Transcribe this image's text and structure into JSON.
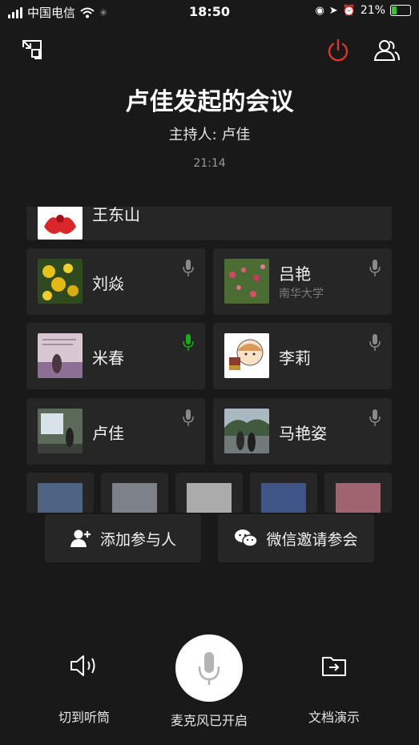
{
  "status": {
    "carrier": "中国电信",
    "time": "18:50",
    "battery": "21%"
  },
  "meeting": {
    "title": "卢佳发起的会议",
    "host_label": "主持人: 卢佳",
    "timer": "21:14"
  },
  "participants": [
    {
      "name": "王东山",
      "sub": "",
      "mic_active": false
    },
    {
      "name": "刘焱",
      "sub": "",
      "mic_active": false
    },
    {
      "name": "吕艳",
      "sub": "南华大学",
      "mic_active": false
    },
    {
      "name": "米春",
      "sub": "",
      "mic_active": true
    },
    {
      "name": "李莉",
      "sub": "",
      "mic_active": false
    },
    {
      "name": "卢佳",
      "sub": "",
      "mic_active": false
    },
    {
      "name": "马艳姿",
      "sub": "",
      "mic_active": false
    }
  ],
  "actions": {
    "add_participant": "添加参与人",
    "wechat_invite": "微信邀请参会"
  },
  "bottom": {
    "earpiece": "切到听筒",
    "mic_status": "麦克风已开启",
    "doc_present": "文档演示"
  },
  "colors": {
    "background": "#191919",
    "card": "#262626",
    "power_red": "#e0352b",
    "mic_active_green": "#1aad19"
  },
  "icons": [
    "minimize-icon",
    "power-icon",
    "members-icon",
    "mic-icon",
    "add-user-icon",
    "wechat-icon",
    "speaker-icon",
    "doc-share-icon"
  ]
}
